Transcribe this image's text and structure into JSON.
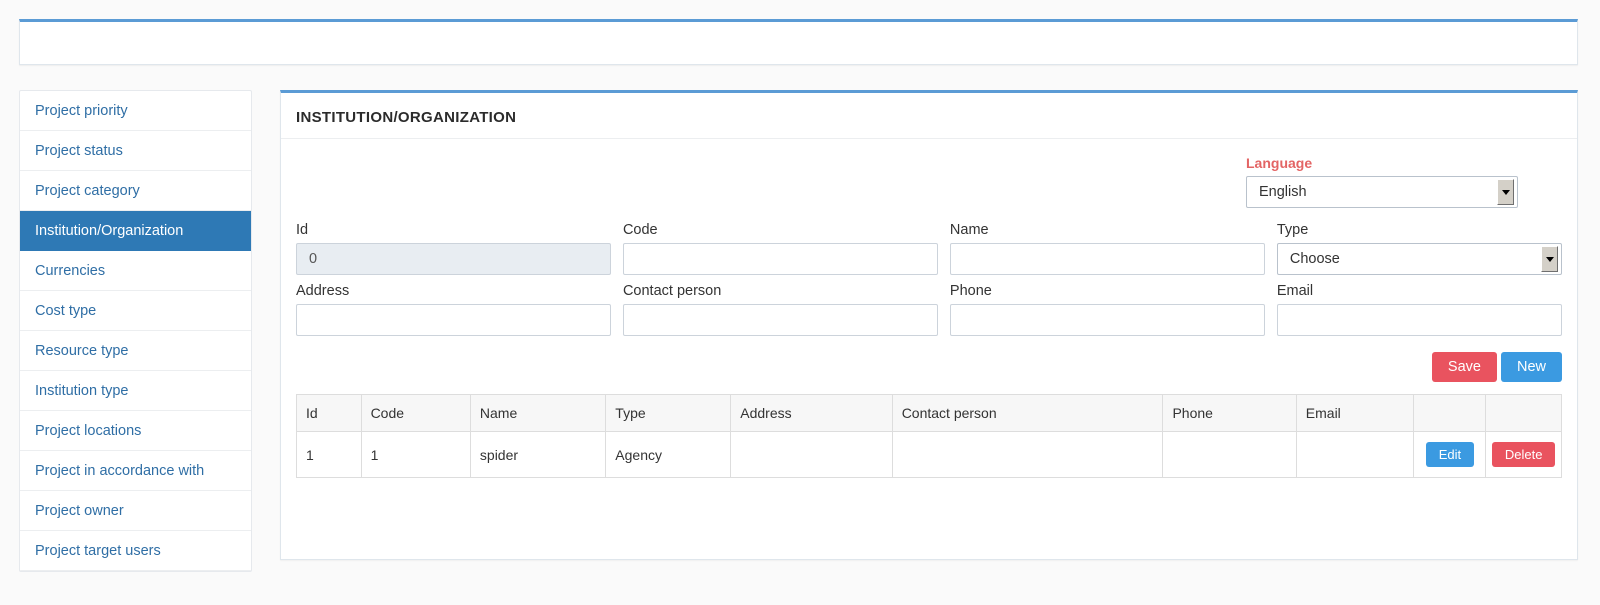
{
  "topbar": {
    "content": ""
  },
  "sidebar": {
    "items": [
      {
        "label": "Project priority",
        "active": false
      },
      {
        "label": "Project status",
        "active": false
      },
      {
        "label": "Project category",
        "active": false
      },
      {
        "label": "Institution/Organization",
        "active": true
      },
      {
        "label": "Currencies",
        "active": false
      },
      {
        "label": "Cost type",
        "active": false
      },
      {
        "label": "Resource type",
        "active": false
      },
      {
        "label": "Institution type",
        "active": false
      },
      {
        "label": "Project locations",
        "active": false
      },
      {
        "label": "Project in accordance with",
        "active": false
      },
      {
        "label": "Project owner",
        "active": false
      },
      {
        "label": "Project target users",
        "active": false
      }
    ]
  },
  "panel": {
    "title": "INSTITUTION/ORGANIZATION",
    "language": {
      "label": "Language",
      "selected": "English",
      "options": [
        "English"
      ]
    },
    "fields": {
      "id": {
        "label": "Id",
        "value": "0",
        "placeholder": "",
        "disabled": true
      },
      "code": {
        "label": "Code",
        "value": "",
        "placeholder": ""
      },
      "name": {
        "label": "Name",
        "value": "",
        "placeholder": ""
      },
      "type": {
        "label": "Type",
        "selected": "Choose",
        "options": [
          "Choose"
        ]
      },
      "address": {
        "label": "Address",
        "value": "",
        "placeholder": ""
      },
      "contact": {
        "label": "Contact person",
        "value": "",
        "placeholder": ""
      },
      "phone": {
        "label": "Phone",
        "value": "",
        "placeholder": ""
      },
      "email": {
        "label": "Email",
        "value": "",
        "placeholder": ""
      }
    },
    "buttons": {
      "save": "Save",
      "new": "New"
    },
    "table": {
      "headers": [
        "Id",
        "Code",
        "Name",
        "Type",
        "Address",
        "Contact person",
        "Phone",
        "Email",
        "",
        ""
      ],
      "rows": [
        {
          "id": "1",
          "code": "1",
          "name": "spider",
          "type": "Agency",
          "address": "",
          "contact": "",
          "phone": "",
          "email": "",
          "edit_label": "Edit",
          "delete_label": "Delete"
        }
      ]
    }
  },
  "colors": {
    "accent_blue": "#2e79b5",
    "panel_border_blue": "#5b9bd5",
    "danger_red": "#e9535f",
    "info_blue": "#3b9ae1",
    "language_label": "#e36464"
  }
}
